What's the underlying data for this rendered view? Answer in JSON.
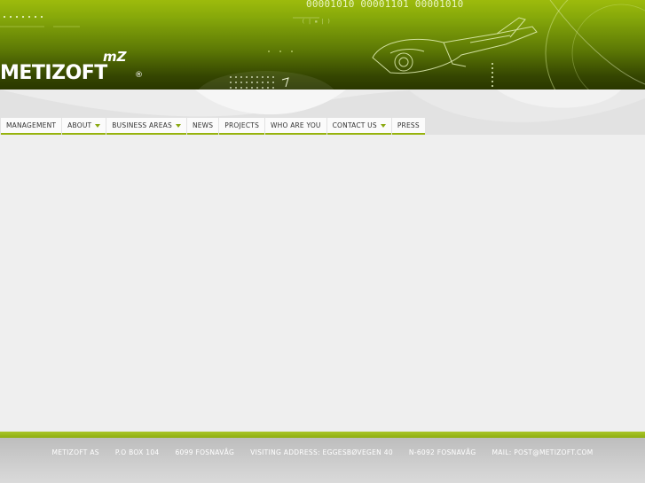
{
  "header": {
    "binary_text": "00001010 00001101 00001010",
    "logo": {
      "text": "METIZOFT",
      "mark": "mZ",
      "registered": "®"
    }
  },
  "nav": {
    "items": [
      {
        "label": "MANAGEMENT",
        "has_dropdown": false
      },
      {
        "label": "ABOUT",
        "has_dropdown": true
      },
      {
        "label": "BUSINESS AREAS",
        "has_dropdown": true
      },
      {
        "label": "NEWS",
        "has_dropdown": false
      },
      {
        "label": "PROJECTS",
        "has_dropdown": false
      },
      {
        "label": "WHO ARE YOU",
        "has_dropdown": false
      },
      {
        "label": "CONTACT US",
        "has_dropdown": true
      },
      {
        "label": "PRESS",
        "has_dropdown": false
      }
    ],
    "accent_color": "#97b30d"
  },
  "footer": {
    "company": "METIZOFT AS",
    "po_box": "P.O BOX 104",
    "postal": "6099 FOSNAVÅG",
    "visiting_address": "VISITING ADDRESS: EGGESBØVEGEN 40",
    "postal2": "N-6092 FOSNAVÅG",
    "mail": "MAIL: POST@METIZOFT.COM"
  },
  "colors": {
    "brand_green": "#9dbb0c",
    "dark_green": "#2a3700",
    "background": "#efefef"
  }
}
